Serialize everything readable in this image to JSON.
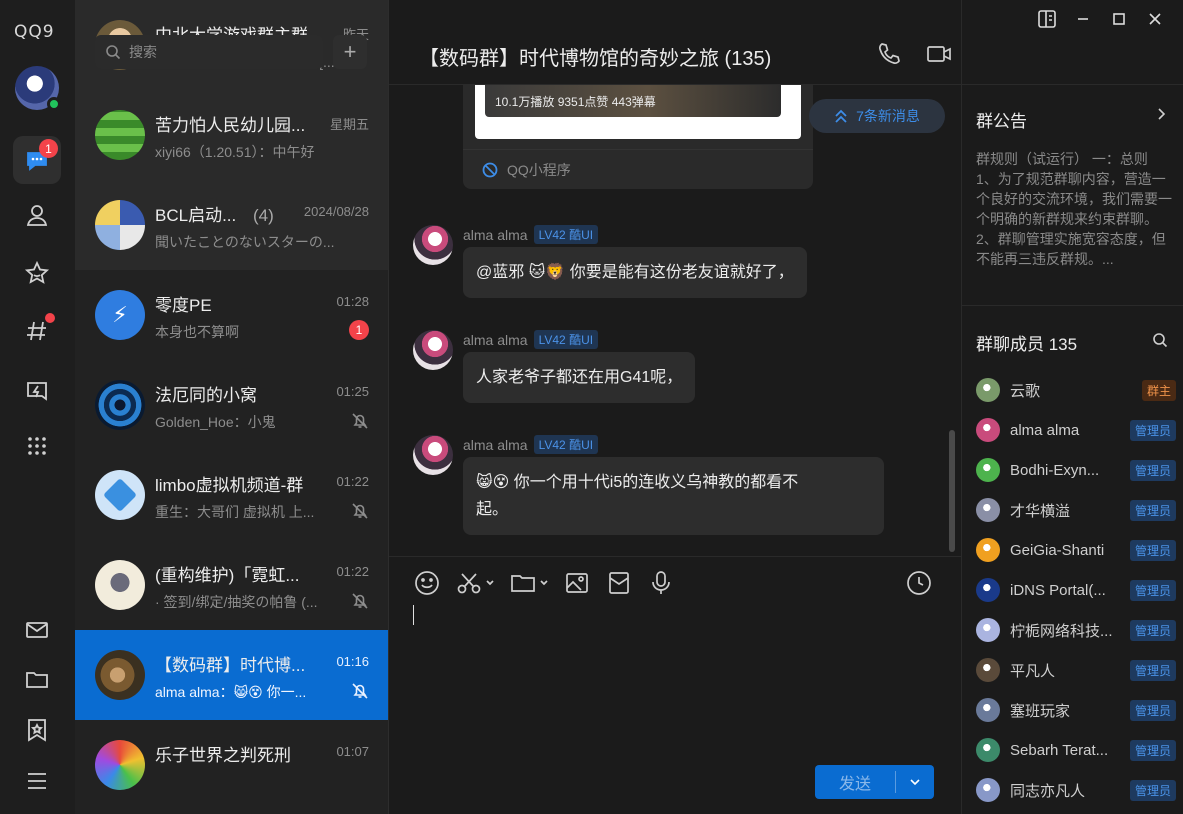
{
  "app": {
    "logo": "QQ9"
  },
  "rail": {
    "messages_badge": "1"
  },
  "search": {
    "placeholder": "搜索"
  },
  "conversations": [
    {
      "title": "中北大学游戏群主群",
      "time": "昨天",
      "preview": "进攻D点！：玩个球的游戏[...",
      "muted": false,
      "badge": ""
    },
    {
      "title": "苦力怕人民幼儿园...",
      "time": "星期五",
      "preview": "xiyi66（1.20.51）：中午好",
      "muted": false,
      "badge": ""
    },
    {
      "title": "BCL启动...",
      "count": "(4)",
      "time": "2024/08/28",
      "preview": "聞いたことのないスターの...",
      "muted": false,
      "badge": ""
    },
    {
      "title": "零度PE",
      "time": "01:28",
      "preview": "本身也不算啊",
      "muted": false,
      "badge": "1"
    },
    {
      "title": "法厄同的小窝",
      "time": "01:25",
      "preview": "Golden_Hoe：小鬼",
      "muted": true,
      "badge": ""
    },
    {
      "title": "limbo虚拟机频道-群",
      "time": "01:22",
      "preview": "重生：大哥们 虚拟机 上...",
      "muted": true,
      "badge": ""
    },
    {
      "title": "(重构维护)「霓虹...",
      "time": "01:22",
      "preview": "· 签到/绑定/抽奖の帕鲁 (...",
      "muted": true,
      "badge": ""
    },
    {
      "title": "【数码群】时代博...",
      "time": "01:16",
      "preview": "alma alma：😸😵 你一...",
      "muted": true,
      "badge": ""
    },
    {
      "title": "乐子世界之判死刑",
      "time": "01:07",
      "preview": "",
      "muted": false,
      "badge": ""
    }
  ],
  "chat": {
    "title": "【数码群】时代博物馆的奇妙之旅 (135)",
    "card_stats": "10.1万播放  9351点赞  443弹幕",
    "card_footer": "QQ小程序",
    "new_messages": "7条新消息",
    "messages": [
      {
        "sender": "alma alma",
        "level": "LV42 酷UI",
        "text": "@蓝邪 🐱🦁 你要是能有这份老友谊就好了，"
      },
      {
        "sender": "alma alma",
        "level": "LV42 酷UI",
        "text": "人家老爷子都还在用G41呢，"
      },
      {
        "sender": "alma alma",
        "level": "LV42 酷UI",
        "text_line1": "😸😵 你一个用十代i5的连收义乌神教的都看不",
        "text_line2": "起。"
      }
    ],
    "send_label": "发送"
  },
  "notice": {
    "title": "群公告",
    "body": "群规则（试运行） 一：总则 1、为了规范群聊内容，营造一个良好的交流环境，我们需要一个明确的新群规来约束群聊。 2、群聊管理实施宽容态度，但不能再三违反群规。..."
  },
  "members": {
    "title": "群聊成员 135",
    "list": [
      {
        "name": "云歌",
        "role": "群主",
        "color": "#7a9a6a"
      },
      {
        "name": "alma alma",
        "role": "管理员",
        "color": "#c94b7c"
      },
      {
        "name": "Bodhi-Exyn...",
        "role": "管理员",
        "color": "#4db34d"
      },
      {
        "name": "才华横溢",
        "role": "管理员",
        "color": "#8a8fa6"
      },
      {
        "name": "GeiGia-Shanti",
        "role": "管理员",
        "color": "#f0a020"
      },
      {
        "name": "iDNS Portal(...",
        "role": "管理员",
        "color": "#1a3a8a"
      },
      {
        "name": "柠栀网络科技...",
        "role": "管理员",
        "color": "#aab4e0"
      },
      {
        "name": "平凡人",
        "role": "管理员",
        "color": "#5a4a3a"
      },
      {
        "name": "塞班玩家",
        "role": "管理员",
        "color": "#6a7a9a"
      },
      {
        "name": "Sebarh Terat...",
        "role": "管理员",
        "color": "#3c8a6a"
      },
      {
        "name": "同志亦凡人",
        "role": "管理员",
        "color": "#8898c8"
      }
    ]
  },
  "colors": {
    "accent": "#0a6cd1",
    "badge": "#f3434a",
    "online": "#21c35c"
  }
}
